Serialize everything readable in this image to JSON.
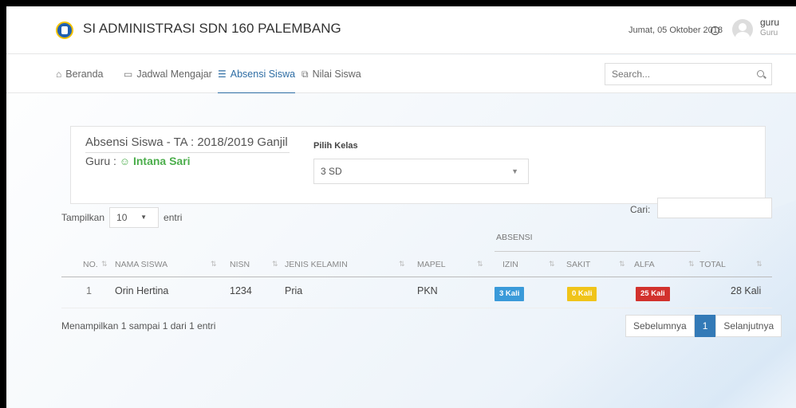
{
  "header": {
    "app_title": "SI ADMINISTRASI SDN 160 PALEMBANG",
    "date": "Jumat, 05 Oktober 2018",
    "user_name": "guru",
    "user_role": "Guru",
    "logo_icon": "school-logo"
  },
  "nav": {
    "items": [
      {
        "label": "Beranda",
        "icon": "home-icon"
      },
      {
        "label": "Jadwal Mengajar",
        "icon": "calendar-icon"
      },
      {
        "label": "Absensi Siswa",
        "icon": "list-icon",
        "active": true
      },
      {
        "label": "Nilai Siswa",
        "icon": "copy-icon"
      }
    ],
    "search_placeholder": "Search..."
  },
  "panel": {
    "title": "Absensi Siswa - TA : 2018/2019 Ganjil",
    "guru_label": "Guru :",
    "guru_name": "Intana Sari",
    "pilih_kelas_label": "Pilih Kelas",
    "selected_kelas": "3 SD"
  },
  "table_controls": {
    "show_label": "Tampilkan",
    "show_value": "10",
    "entries_label": "entri",
    "search_label": "Cari:",
    "search_value": ""
  },
  "table": {
    "group_header": "ABSENSI",
    "columns": [
      "NO.",
      "NAMA SISWA",
      "NISN",
      "JENIS KELAMIN",
      "MAPEL",
      "IZIN",
      "SAKIT",
      "ALFA",
      "TOTAL"
    ],
    "rows": [
      {
        "no": "1",
        "nama": "Orin Hertina",
        "nisn": "1234",
        "jk": "Pria",
        "mapel": "PKN",
        "izin": "3 Kali",
        "sakit": "0 Kali",
        "alfa": "25 Kali",
        "total": "28 Kali"
      }
    ],
    "badge_colors": {
      "izin": "#3a9ad9",
      "sakit": "#f0c419",
      "alfa": "#d2322d"
    }
  },
  "footer": {
    "info": "Menampilkan 1 sampai 1 dari 1 entri",
    "prev_label": "Sebelumnya",
    "current_page": "1",
    "next_label": "Selanjutnya"
  },
  "colors": {
    "accent": "#2e6da4",
    "guru_name": "#4cae4c"
  }
}
